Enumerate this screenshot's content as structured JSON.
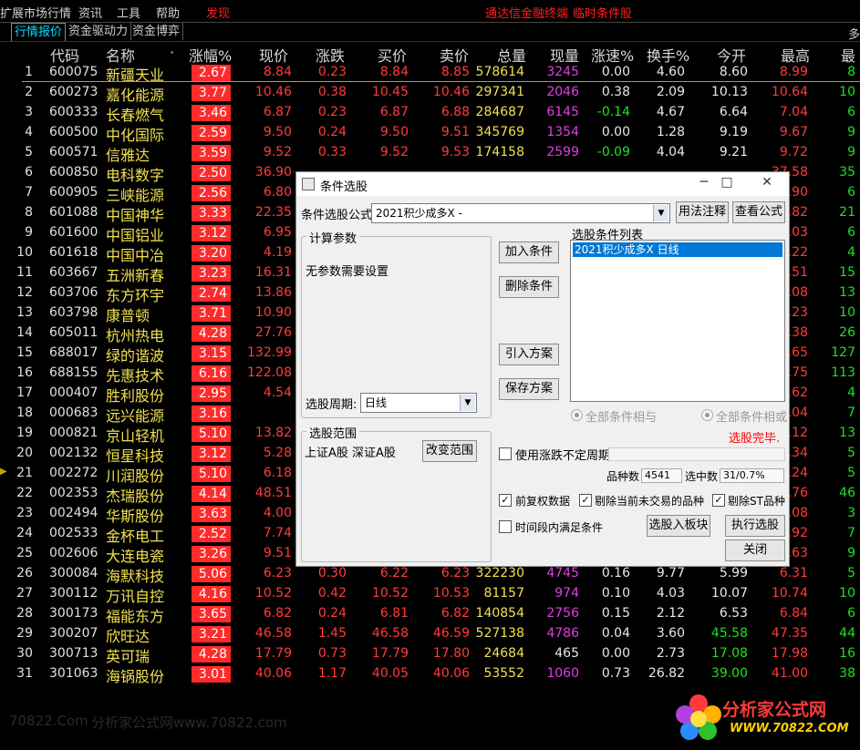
{
  "menu": {
    "items": [
      "扩展市场行情",
      "资讯",
      "工具",
      "帮助"
    ],
    "flash": "发现",
    "center": "通达信金融终端",
    "right": "临时条件股"
  },
  "tabs": [
    "行情报价",
    "资金驱动力",
    "资金博弈"
  ],
  "top_right": "多",
  "columns": {
    "code": "代码",
    "name": "名称",
    "dot": "·",
    "pct": "涨幅%",
    "price": "现价",
    "chg": "涨跌",
    "bid": "买价",
    "ask": "卖价",
    "vol": "总量",
    "cur": "现量",
    "speed": "涨速%",
    "turn": "换手%",
    "open": "今开",
    "high": "最高",
    "last": "最"
  },
  "rows": [
    {
      "i": "1",
      "code": "600075",
      "name": "新疆天业",
      "pct": "2.67",
      "price": "8.84",
      "chg": "0.23",
      "bid": "8.84",
      "ask": "8.85",
      "vol": "578614",
      "cur": "3245",
      "speed": "0.00",
      "turn": "4.60",
      "open": "8.60",
      "high": "8.99",
      "last": "8"
    },
    {
      "i": "2",
      "code": "600273",
      "name": "嘉化能源",
      "pct": "3.77",
      "price": "10.46",
      "chg": "0.38",
      "bid": "10.45",
      "ask": "10.46",
      "vol": "297341",
      "cur": "2046",
      "speed": "0.38",
      "turn": "2.09",
      "open": "10.13",
      "high": "10.64",
      "last": "10"
    },
    {
      "i": "3",
      "code": "600333",
      "name": "长春燃气",
      "pct": "3.46",
      "price": "6.87",
      "chg": "0.23",
      "bid": "6.87",
      "ask": "6.88",
      "vol": "284687",
      "cur": "6145",
      "speed": "-0.14",
      "turn": "4.67",
      "open": "6.64",
      "high": "7.04",
      "last": "6"
    },
    {
      "i": "4",
      "code": "600500",
      "name": "中化国际",
      "pct": "2.59",
      "price": "9.50",
      "chg": "0.24",
      "bid": "9.50",
      "ask": "9.51",
      "vol": "345769",
      "cur": "1354",
      "speed": "0.00",
      "turn": "1.28",
      "open": "9.19",
      "high": "9.67",
      "last": "9"
    },
    {
      "i": "5",
      "code": "600571",
      "name": "信雅达",
      "pct": "3.59",
      "price": "9.52",
      "chg": "0.33",
      "bid": "9.52",
      "ask": "9.53",
      "vol": "174158",
      "cur": "2599",
      "speed": "-0.09",
      "turn": "4.04",
      "open": "9.21",
      "high": "9.72",
      "last": "9"
    },
    {
      "i": "6",
      "code": "600850",
      "name": "电科数字",
      "pct": "2.50",
      "price": "36.90",
      "chg": "",
      "bid": "",
      "ask": "",
      "vol": "",
      "cur": "",
      "speed": "",
      "turn": "",
      "open": "",
      "high": "37.58",
      "last": "35"
    },
    {
      "i": "7",
      "code": "600905",
      "name": "三峡能源",
      "pct": "2.56",
      "price": "6.80",
      "chg": "",
      "bid": "",
      "ask": "",
      "vol": "",
      "cur": "",
      "speed": "",
      "turn": "",
      "open": "",
      "high": ".90",
      "last": "6"
    },
    {
      "i": "8",
      "code": "601088",
      "name": "中国神华",
      "pct": "3.33",
      "price": "22.35",
      "chg": "",
      "bid": "",
      "ask": "",
      "vol": "",
      "cur": "",
      "speed": "",
      "turn": "",
      "open": "",
      "high": ".82",
      "last": "21"
    },
    {
      "i": "9",
      "code": "601600",
      "name": "中国铝业",
      "pct": "3.12",
      "price": "6.95",
      "chg": "",
      "bid": "",
      "ask": "",
      "vol": "",
      "cur": "",
      "speed": "",
      "turn": "",
      "open": "",
      "high": ".03",
      "last": "6"
    },
    {
      "i": "10",
      "code": "601618",
      "name": "中国中冶",
      "pct": "3.20",
      "price": "4.19",
      "chg": "",
      "bid": "",
      "ask": "",
      "vol": "",
      "cur": "",
      "speed": "",
      "turn": "",
      "open": "",
      "high": ".22",
      "last": "4"
    },
    {
      "i": "11",
      "code": "603667",
      "name": "五洲新春",
      "pct": "3.23",
      "price": "16.31",
      "chg": "",
      "bid": "",
      "ask": "",
      "vol": "",
      "cur": "",
      "speed": "",
      "turn": "",
      "open": "",
      "high": ".51",
      "last": "15"
    },
    {
      "i": "12",
      "code": "603706",
      "name": "东方环宇",
      "pct": "2.74",
      "price": "13.86",
      "chg": "",
      "bid": "",
      "ask": "",
      "vol": "",
      "cur": "",
      "speed": "",
      "turn": "",
      "open": "",
      "high": ".08",
      "last": "13"
    },
    {
      "i": "13",
      "code": "603798",
      "name": "康普顿",
      "pct": "3.71",
      "price": "10.90",
      "chg": "",
      "bid": "",
      "ask": "",
      "vol": "",
      "cur": "",
      "speed": "",
      "turn": "",
      "open": "",
      "high": ".23",
      "last": "10"
    },
    {
      "i": "14",
      "code": "605011",
      "name": "杭州热电",
      "pct": "4.28",
      "price": "27.76",
      "chg": "",
      "bid": "",
      "ask": "",
      "vol": "",
      "cur": "",
      "speed": "",
      "turn": "",
      "open": "",
      "high": ".38",
      "last": "26"
    },
    {
      "i": "15",
      "code": "688017",
      "name": "绿的谐波",
      "pct": "3.15",
      "price": "132.99",
      "chg": "",
      "bid": "",
      "ask": "",
      "vol": "",
      "cur": "",
      "speed": "",
      "turn": "",
      "open": "",
      "high": ".65",
      "last": "127"
    },
    {
      "i": "16",
      "code": "688155",
      "name": "先惠技术",
      "pct": "6.16",
      "price": "122.08",
      "chg": "",
      "bid": "",
      "ask": "",
      "vol": "",
      "cur": "",
      "speed": "",
      "turn": "",
      "open": "",
      "high": ".75",
      "last": "113"
    },
    {
      "i": "17",
      "code": "000407",
      "name": "胜利股份",
      "pct": "2.95",
      "price": "4.54",
      "chg": "",
      "bid": "",
      "ask": "",
      "vol": "",
      "cur": "",
      "speed": "",
      "turn": "",
      "open": "",
      "high": ".62",
      "last": "4"
    },
    {
      "i": "18",
      "code": "000683",
      "name": "远兴能源",
      "pct": "3.16",
      "price": "",
      "chg": "",
      "bid": "",
      "ask": "",
      "vol": "",
      "cur": "",
      "speed": "",
      "turn": "",
      "open": "",
      "high": ".04",
      "last": "7"
    },
    {
      "i": "19",
      "code": "000821",
      "name": "京山轻机",
      "pct": "5.10",
      "price": "13.82",
      "chg": "",
      "bid": "",
      "ask": "",
      "vol": "",
      "cur": "",
      "speed": "",
      "turn": "",
      "open": "",
      "high": ".12",
      "last": "13"
    },
    {
      "i": "20",
      "code": "002132",
      "name": "恒星科技",
      "pct": "3.12",
      "price": "5.28",
      "chg": "",
      "bid": "",
      "ask": "",
      "vol": "",
      "cur": "",
      "speed": "",
      "turn": "",
      "open": "",
      "high": ".34",
      "last": "5"
    },
    {
      "i": "21",
      "code": "002272",
      "name": "川润股份",
      "pct": "5.10",
      "price": "6.18",
      "chg": "",
      "bid": "",
      "ask": "",
      "vol": "",
      "cur": "",
      "speed": "",
      "turn": "",
      "open": "",
      "high": ".24",
      "last": "5"
    },
    {
      "i": "22",
      "code": "002353",
      "name": "杰瑞股份",
      "pct": "4.14",
      "price": "48.51",
      "chg": "",
      "bid": "",
      "ask": "",
      "vol": "",
      "cur": "",
      "speed": "",
      "turn": "",
      "open": "",
      "high": ".76",
      "last": "46"
    },
    {
      "i": "23",
      "code": "002494",
      "name": "华斯股份",
      "pct": "3.63",
      "price": "4.00",
      "chg": "",
      "bid": "",
      "ask": "",
      "vol": "",
      "cur": "",
      "speed": "",
      "turn": "",
      "open": "",
      "high": ".08",
      "last": "3"
    },
    {
      "i": "24",
      "code": "002533",
      "name": "金杯电工",
      "pct": "2.52",
      "price": "7.74",
      "chg": "",
      "bid": "",
      "ask": "",
      "vol": "",
      "cur": "",
      "speed": "",
      "turn": "",
      "open": "",
      "high": ".92",
      "last": "7"
    },
    {
      "i": "25",
      "code": "002606",
      "name": "大连电瓷",
      "pct": "3.26",
      "price": "9.51",
      "chg": "",
      "bid": "",
      "ask": "",
      "vol": "",
      "cur": "",
      "speed": "",
      "turn": "",
      "open": "",
      "high": ".63",
      "last": "9"
    },
    {
      "i": "26",
      "code": "300084",
      "name": "海默科技",
      "pct": "5.06",
      "price": "6.23",
      "chg": "0.30",
      "bid": "6.22",
      "ask": "6.23",
      "vol": "322230",
      "cur": "4745",
      "speed": "0.16",
      "turn": "9.77",
      "open": "5.99",
      "high": "6.31",
      "last": "5"
    },
    {
      "i": "27",
      "code": "300112",
      "name": "万讯自控",
      "pct": "4.16",
      "price": "10.52",
      "chg": "0.42",
      "bid": "10.52",
      "ask": "10.53",
      "vol": "81157",
      "cur": "974",
      "speed": "0.10",
      "turn": "4.03",
      "open": "10.07",
      "high": "10.74",
      "last": "10"
    },
    {
      "i": "28",
      "code": "300173",
      "name": "福能东方",
      "pct": "3.65",
      "price": "6.82",
      "chg": "0.24",
      "bid": "6.81",
      "ask": "6.82",
      "vol": "140854",
      "cur": "2756",
      "speed": "0.15",
      "turn": "2.12",
      "open": "6.53",
      "high": "6.84",
      "last": "6"
    },
    {
      "i": "29",
      "code": "300207",
      "name": "欣旺达",
      "pct": "3.21",
      "price": "46.58",
      "chg": "1.45",
      "bid": "46.58",
      "ask": "46.59",
      "vol": "527138",
      "cur": "4786",
      "speed": "0.04",
      "turn": "3.60",
      "open": "45.58",
      "high": "47.35",
      "last": "44"
    },
    {
      "i": "30",
      "code": "300713",
      "name": "英可瑞",
      "pct": "4.28",
      "price": "17.79",
      "chg": "0.73",
      "bid": "17.79",
      "ask": "17.80",
      "vol": "24684",
      "cur": "465",
      "speed": "0.00",
      "turn": "2.73",
      "open": "17.08",
      "high": "17.98",
      "last": "16"
    },
    {
      "i": "31",
      "code": "301063",
      "name": "海锅股份",
      "pct": "3.01",
      "price": "40.06",
      "chg": "1.17",
      "bid": "40.05",
      "ask": "40.06",
      "vol": "53552",
      "cur": "1060",
      "speed": "0.73",
      "turn": "26.82",
      "open": "39.00",
      "high": "41.00",
      "last": "38"
    }
  ],
  "dialog": {
    "title": "条件选股",
    "formula_label": "条件选股公式",
    "formula_value": "2021积少成多X -",
    "usage_btn": "用法注释",
    "view_formula_btn": "查看公式",
    "calc_params_label": "计算参数",
    "no_params": "无参数需要设置",
    "add_cond_btn": "加入条件",
    "del_cond_btn": "删除条件",
    "import_btn": "引入方案",
    "save_btn": "保存方案",
    "cond_list_label": "选股条件列表",
    "cond_item": "2021积少成多X  日线",
    "period_label": "选股周期:",
    "period_value": "日线",
    "radio_and": "全部条件相与",
    "radio_or": "全部条件相或",
    "range_label": "选股范围",
    "range_value": "上证A股  深证A股",
    "change_range_btn": "改变范围",
    "done_text": "选股完毕.",
    "use_period_label": "使用涨跌不定周期",
    "count_label": "品种数",
    "count_value": "4541",
    "selected_label": "选中数",
    "selected_value": "31/0.7%",
    "check_rights": "前复权数据",
    "check_notrade": "剔除当前未交易的品种",
    "check_st": "剔除ST品种",
    "check_timerange": "时间段内满足条件",
    "to_block_btn": "选股入板块",
    "run_btn": "执行选股",
    "close_btn": "关闭"
  },
  "watermark": {
    "domain": "70822.Com",
    "site": "分析家公式网www.70822.com",
    "logo_title": "分析家公式网",
    "logo_url": "WWW.70822.COM"
  }
}
